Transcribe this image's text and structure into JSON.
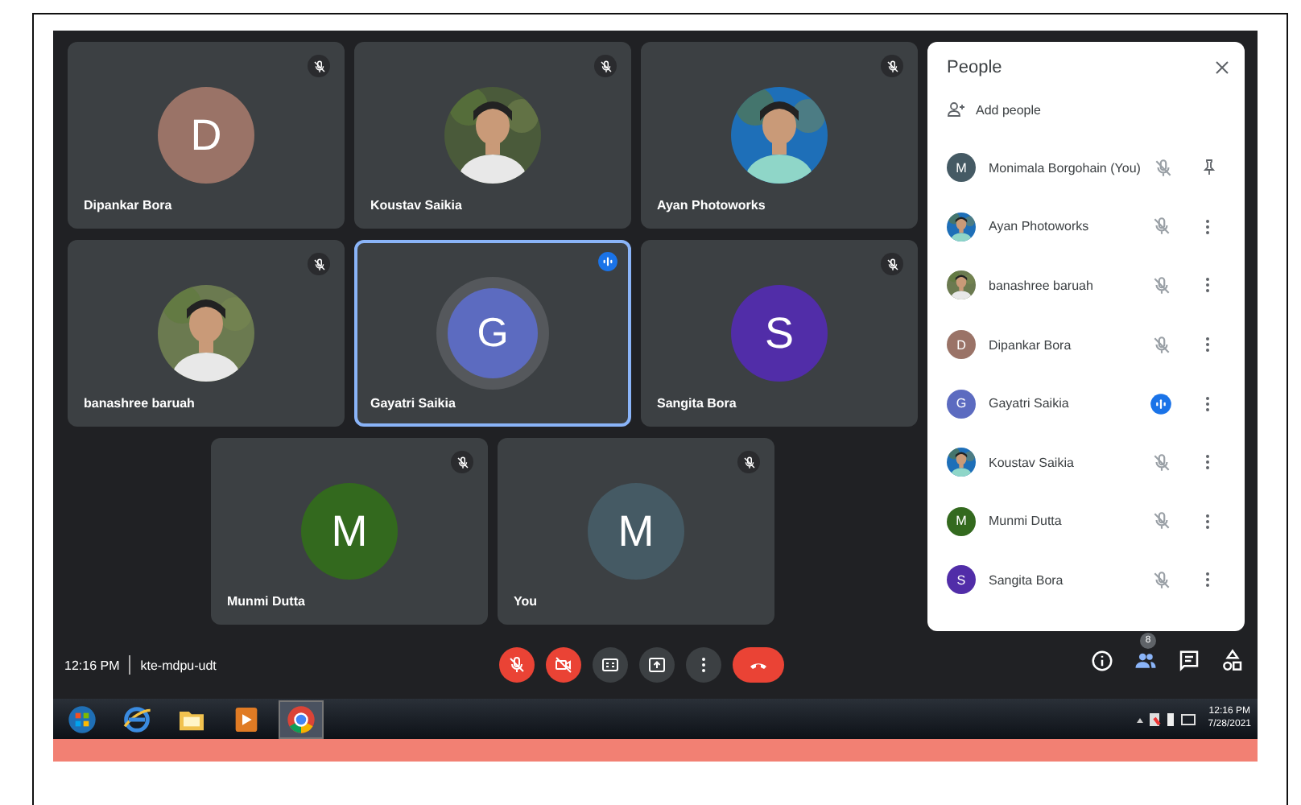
{
  "tiles": [
    {
      "name": "Dipankar Bora",
      "avatar": {
        "kind": "letter",
        "letter": "D",
        "color": "#9a7367"
      },
      "muted": true,
      "speaking": false,
      "selected": false
    },
    {
      "name": "Koustav Saikia",
      "muted": true,
      "speaking": false,
      "selected": false
    },
    {
      "name": "Ayan Photoworks",
      "muted": true,
      "speaking": false,
      "selected": false
    },
    {
      "name": "banashree baruah",
      "muted": true,
      "speaking": false,
      "selected": false
    },
    {
      "name": "Gayatri Saikia",
      "avatar": {
        "kind": "letter",
        "letter": "G",
        "color": "#5c6bc0"
      },
      "muted": false,
      "speaking": true,
      "selected": true
    },
    {
      "name": "Sangita Bora",
      "avatar": {
        "kind": "letter",
        "letter": "S",
        "color": "#512da8"
      },
      "muted": true,
      "speaking": false,
      "selected": false
    },
    {
      "name": "Munmi Dutta",
      "avatar": {
        "kind": "letter",
        "letter": "M",
        "color": "#33691e"
      },
      "muted": true,
      "speaking": false,
      "selected": false
    },
    {
      "name": "You",
      "avatar": {
        "kind": "letter",
        "letter": "M",
        "color": "#455a64"
      },
      "muted": true,
      "speaking": false,
      "selected": false
    }
  ],
  "people_panel": {
    "title": "People",
    "add_label": "Add people",
    "people": [
      {
        "name": "Monimala Borgohain (You)",
        "avatar": {
          "kind": "letter",
          "letter": "M",
          "color": "#455a64"
        },
        "speaking": false,
        "kind": "pin"
      },
      {
        "name": "Ayan Photoworks",
        "speaking": false,
        "kind": "more"
      },
      {
        "name": "banashree baruah",
        "speaking": false,
        "kind": "more"
      },
      {
        "name": "Dipankar Bora",
        "avatar": {
          "kind": "letter",
          "letter": "D",
          "color": "#9a7367"
        },
        "speaking": false,
        "kind": "more"
      },
      {
        "name": "Gayatri Saikia",
        "avatar": {
          "kind": "letter",
          "letter": "G",
          "color": "#5c6bc0"
        },
        "speaking": true,
        "kind": "more"
      },
      {
        "name": "Koustav Saikia",
        "speaking": false,
        "kind": "more"
      },
      {
        "name": "Munmi Dutta",
        "avatar": {
          "kind": "letter",
          "letter": "M",
          "color": "#33691e"
        },
        "speaking": false,
        "kind": "more"
      },
      {
        "name": "Sangita Bora",
        "avatar": {
          "kind": "letter",
          "letter": "S",
          "color": "#512da8"
        },
        "speaking": false,
        "kind": "more"
      }
    ]
  },
  "bottom_bar": {
    "time": "12:16 PM",
    "meeting_code": "kte-mdpu-udt",
    "controls": [
      {
        "kind": "mic-off",
        "danger": true
      },
      {
        "kind": "camera-off",
        "danger": true
      },
      {
        "kind": "captions",
        "danger": false
      },
      {
        "kind": "present",
        "danger": false
      },
      {
        "kind": "more",
        "danger": false
      },
      {
        "kind": "end-call",
        "danger": true
      }
    ],
    "right_icons": [
      {
        "kind": "info"
      },
      {
        "kind": "people",
        "badge": "8"
      },
      {
        "kind": "chat"
      },
      {
        "kind": "activities"
      }
    ]
  },
  "taskbar": {
    "apps": [
      {
        "kind": "start",
        "selected": false
      },
      {
        "kind": "browser",
        "selected": false
      },
      {
        "kind": "folder",
        "selected": false
      },
      {
        "kind": "media",
        "selected": false
      },
      {
        "kind": "chrome",
        "selected": true
      }
    ],
    "tray_time": "12:16 PM",
    "tray_date": "7/28/2021"
  }
}
